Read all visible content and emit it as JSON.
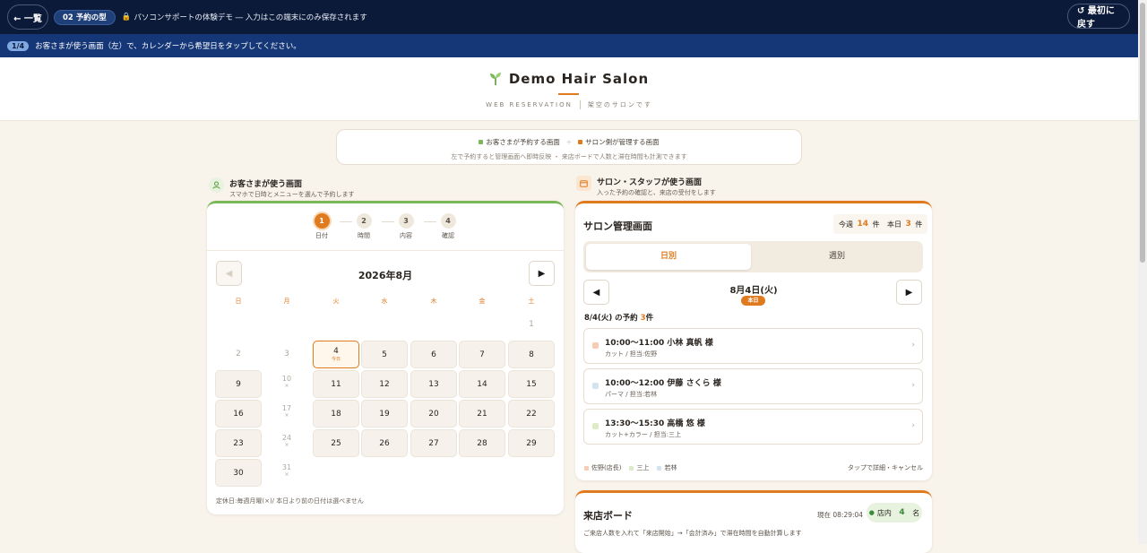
{
  "topbar": {
    "back_label": "← 一覧",
    "badge": "02 予約の型",
    "demo_note": "パソコンサポートの体験デモ ― 入力はこの端末にのみ保存されます",
    "reset_label": "↺ 最初に戻す"
  },
  "stepbar": {
    "step": "1/4",
    "instruction": "お客さまが使う画面（左）で、カレンダーから希望日をタップしてください。"
  },
  "header": {
    "title": "Demo Hair Salon",
    "sub_en": "WEB RESERVATION",
    "sub_jp": "架空のサロンです"
  },
  "legend": {
    "customer": "お客さまが予約する画面",
    "salon": "サロン側が管理する画面",
    "note": "左で予約すると管理画面へ即時反映 ・ 来店ボードで人数と滞在時間も計測できます"
  },
  "customer": {
    "title": "お客さまが使う画面",
    "subtitle": "スマホで日時とメニューを選んで予約します",
    "steps": [
      {
        "num": "1",
        "label": "日付"
      },
      {
        "num": "2",
        "label": "時間"
      },
      {
        "num": "3",
        "label": "内容"
      },
      {
        "num": "4",
        "label": "確認"
      }
    ],
    "month": "2026年8月",
    "weekdays": [
      "日",
      "月",
      "火",
      "水",
      "木",
      "金",
      "土"
    ],
    "closed_mark": "×",
    "today_label": "今日",
    "footnote": "定休日:毎週月曜(×)/ 本日より前の日付は選べません"
  },
  "salon": {
    "title": "サロン・スタッフが使う画面",
    "subtitle": "入った予約の確認と、来店の受付をします",
    "card_title": "サロン管理画面",
    "week_label": "今週",
    "week_count": "14",
    "today_label": "本日",
    "today_count": "3",
    "unit": "件",
    "tabs": [
      "日別",
      "週別"
    ],
    "date": "8月4日(火)",
    "today_badge": "本日",
    "count_prefix": "8/4(火) の予約",
    "count_num": "3",
    "count_suffix": "件",
    "appointments": [
      {
        "time_name": "10:00〜11:00 小林 真帆 様",
        "detail": "カット / 担当:佐野",
        "color": "#f6cdb4"
      },
      {
        "time_name": "10:00〜12:00 伊藤 さくら 様",
        "detail": "パーマ / 担当:若林",
        "color": "#d3e4ee"
      },
      {
        "time_name": "13:30〜15:30 高橋 悠 様",
        "detail": "カット+カラー / 担当:三上",
        "color": "#dcecc6"
      }
    ],
    "staff": [
      {
        "name": "佐野(店長)",
        "color": "#f6cdb4"
      },
      {
        "name": "三上",
        "color": "#dcecc6"
      },
      {
        "name": "若林",
        "color": "#d3e4ee"
      }
    ],
    "tap_note": "タップで詳細・キャンセル"
  },
  "board": {
    "title": "来店ボード",
    "time": "現在 08:29:04",
    "chip_prefix": "店内",
    "chip_count": "4",
    "chip_suffix": "名",
    "note": "ご来店人数を入れて「来店開始」→「会計済み」で滞在時間を自動計算します"
  },
  "colors": {
    "accent": "#e07a1f",
    "navy": "#0c1a3a",
    "green": "#7bb85a"
  }
}
